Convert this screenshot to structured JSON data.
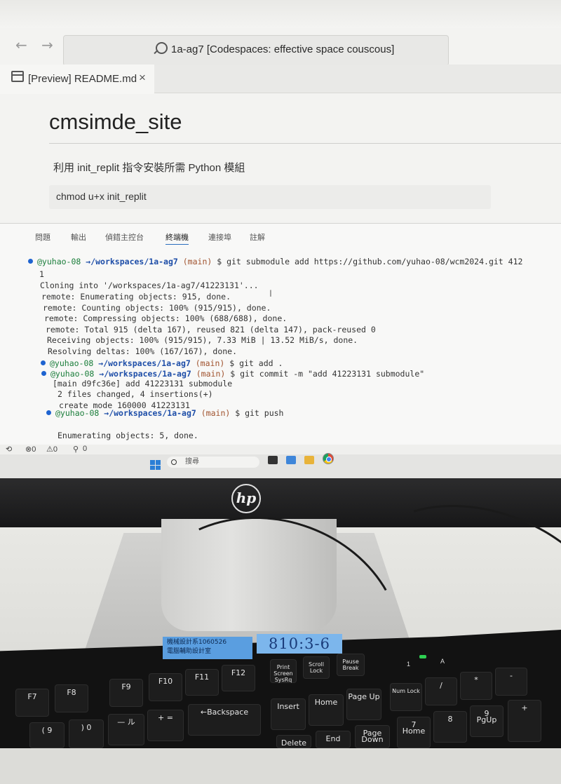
{
  "browser": {
    "nav_back": "←",
    "nav_forward": "→",
    "search_text": "1a-ag7 [Codespaces: effective space couscous]"
  },
  "editor_tab": {
    "label": "[Preview] README.md",
    "close": "×"
  },
  "readme": {
    "title": "cmsimde_site",
    "paragraph1": "利用 init_replit 指令安裝所需 Python 模組",
    "code": "chmod u+x init_replit"
  },
  "panel_tabs": [
    "問題",
    "輸出",
    "偵錯主控台",
    "終端機",
    "連接埠",
    "註解"
  ],
  "terminal": {
    "prompt_user": "@yuhao-08",
    "prompt_arrow": "→",
    "prompt_path": "/workspaces/1a-ag7",
    "prompt_branch": "(main)",
    "cmd1": "$ git submodule add https://github.com/yuhao-08/wcm2024.git 412",
    "cmd1_wrap": "1",
    "out1": [
      "Cloning into '/workspaces/1a-ag7/41223131'...",
      "remote: Enumerating objects: 915, done.",
      "remote: Counting objects: 100% (915/915), done.",
      "remote: Compressing objects: 100% (688/688), done.",
      "remote: Total 915 (delta 167), reused 821 (delta 147), pack-reused 0",
      "Receiving objects: 100% (915/915), 7.33 MiB | 13.52 MiB/s, done.",
      "Resolving deltas: 100% (167/167), done."
    ],
    "cmd2": "$ git add .",
    "cmd3": "$ git commit -m \"add 41223131 submodule\"",
    "out3": [
      "[main d9fc36e] add 41223131 submodule",
      "2 files changed, 4 insertions(+)",
      "create mode 160000 41223131"
    ],
    "cmd4": "$ git push",
    "out4": "Enumerating objects: 5, done."
  },
  "statusbar": {
    "errors": "⊗0",
    "warnings": "⚠0",
    "ports": "0"
  },
  "taskbar": {
    "search_placeholder": "搜尋"
  },
  "monitor": {
    "brand": "hp"
  },
  "stickers": {
    "dept_line1": "機械設計系1060526",
    "dept_line2": "電腦輔助設計室",
    "room": "810:3-6"
  },
  "keys": {
    "print": "Print Screen SysRq",
    "scroll": "Scroll Lock",
    "pause": "Pause Break",
    "f7": "F7",
    "f8": "F8",
    "f9": "F9",
    "f10": "F10",
    "f11": "F11",
    "f12": "F12",
    "backspace": "←Backspace",
    "insert": "Insert",
    "home": "Home",
    "pageup": "Page Up",
    "numlock": "Num Lock",
    "delete": "Delete",
    "end": "End",
    "pagedown": "Page Down",
    "num7": "7",
    "num7sub": "Home",
    "num8": "8",
    "num9": "9",
    "num9sub": "PgUp",
    "slash": "/",
    "star": "*",
    "minus": "-",
    "plus": "+",
    "num_one": "1",
    "num_a": "A",
    "k9": "( 9",
    "k0": ") 0",
    "kminus": "— ル",
    "kequals": "+ ="
  }
}
